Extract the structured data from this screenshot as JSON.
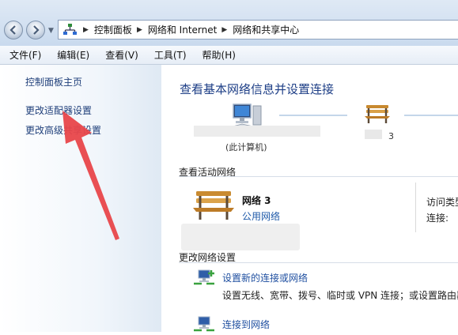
{
  "address_bar": {
    "crumbs": [
      "控制面板",
      "网络和 Internet",
      "网络和共享中心"
    ]
  },
  "menu": {
    "items": [
      "文件(F)",
      "编辑(E)",
      "查看(V)",
      "工具(T)",
      "帮助(H)"
    ]
  },
  "sidebar": {
    "items": [
      "控制面板主页",
      "更改适配器设置",
      "更改高级共享设置"
    ]
  },
  "main": {
    "title": "查看基本网络信息并设置连接",
    "map": {
      "pc_label": "(此计算机)",
      "network_label": "3"
    },
    "active_section": "查看活动网络",
    "network": {
      "name": "网络  3",
      "type": "公用网络",
      "access_label": "访问类型",
      "connection_label": "连接:"
    },
    "change_section": "更改网络设置",
    "tasks": [
      {
        "link": "设置新的连接或网络",
        "desc": "设置无线、宽带、拨号、临时或 VPN 连接；或设置路由器"
      },
      {
        "link": "连接到网络",
        "desc": ""
      }
    ]
  },
  "colors": {
    "link": "#1f3f7a",
    "title": "#1d3e86",
    "annotation_arrow": "#e8464a"
  }
}
